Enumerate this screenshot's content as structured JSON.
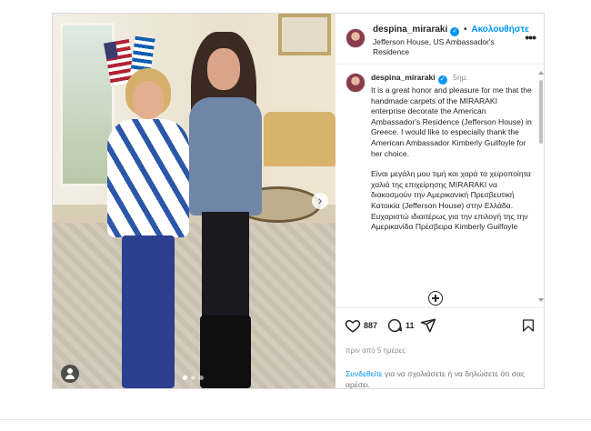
{
  "post": {
    "username": "despina_miraraki",
    "follow_label": "Ακολουθήστε",
    "separator": "•",
    "location": "Jefferson House, US Ambassador's Residence",
    "more_label": "•••",
    "carousel_next": "›"
  },
  "caption": {
    "username": "despina_miraraki",
    "time": "5ημ.",
    "text_en": "It is a great honor and pleasure for me that the handmade carpets of the MIRARAKI enterprise decorate the American Ambassador's Residence (Jefferson House) in Greece. I would like to especially thank the American Ambassador Kimberly Guilfoyle for her choice.",
    "text_gr": "Είναι μεγάλη μου τιμή και χαρά τα χειροποίητα χαλιά της επιχείρησης MIRARAKI να διακοσμούν την Αμερικανική Πρεσβευτική Κατοικία (Jefferson House) στην Ελλάδα. Ευχαριστώ ιδιαιτέρως για την επιλογή της την Αμερικανίδα Πρέσβειρα Kimberly Guilfoyle"
  },
  "actions": {
    "likes": "887",
    "comments": "11",
    "time_ago": "πριν από 5 ημέρες",
    "login_link": "Συνδεθείτε",
    "login_rest": " για να σχολιάσετε ή να δηλώσετε ότι σας αρέσει."
  },
  "colors": {
    "accent": "#0095f6",
    "text": "#262626",
    "muted": "#8e8e8e",
    "border": "#dbdbdb"
  },
  "icons": [
    "verified-badge-icon",
    "more-options-icon",
    "heart-icon",
    "comment-icon",
    "share-icon",
    "bookmark-icon",
    "add-comment-icon",
    "user-tag-icon",
    "chevron-right-icon"
  ]
}
